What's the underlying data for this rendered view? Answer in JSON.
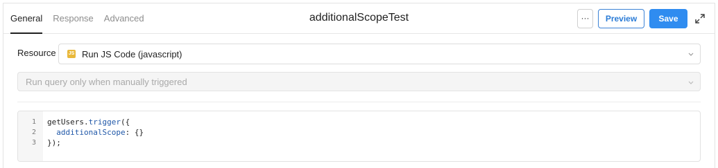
{
  "header": {
    "tabs": [
      {
        "label": "General",
        "active": true
      },
      {
        "label": "Response",
        "active": false
      },
      {
        "label": "Advanced",
        "active": false
      }
    ],
    "title": "additionalScopeTest",
    "more_label": "···",
    "preview_label": "Preview",
    "save_label": "Save",
    "expand_icon": "expand-icon"
  },
  "resource": {
    "label": "Resource",
    "badge": "JS",
    "value": "Run JS Code (javascript)"
  },
  "trigger": {
    "value": "Run query only when manually triggered"
  },
  "editor": {
    "line_numbers": [
      "1",
      "2",
      "3"
    ],
    "lines": [
      {
        "a": "getUsers.",
        "b": "trigger",
        "c": "({"
      },
      {
        "a": "  ",
        "b": "additionalScope",
        "c": ": {}"
      },
      {
        "a": "});",
        "b": "",
        "c": ""
      }
    ]
  },
  "colors": {
    "accent": "#2f8cf0",
    "js_badge": "#e9b83a"
  }
}
